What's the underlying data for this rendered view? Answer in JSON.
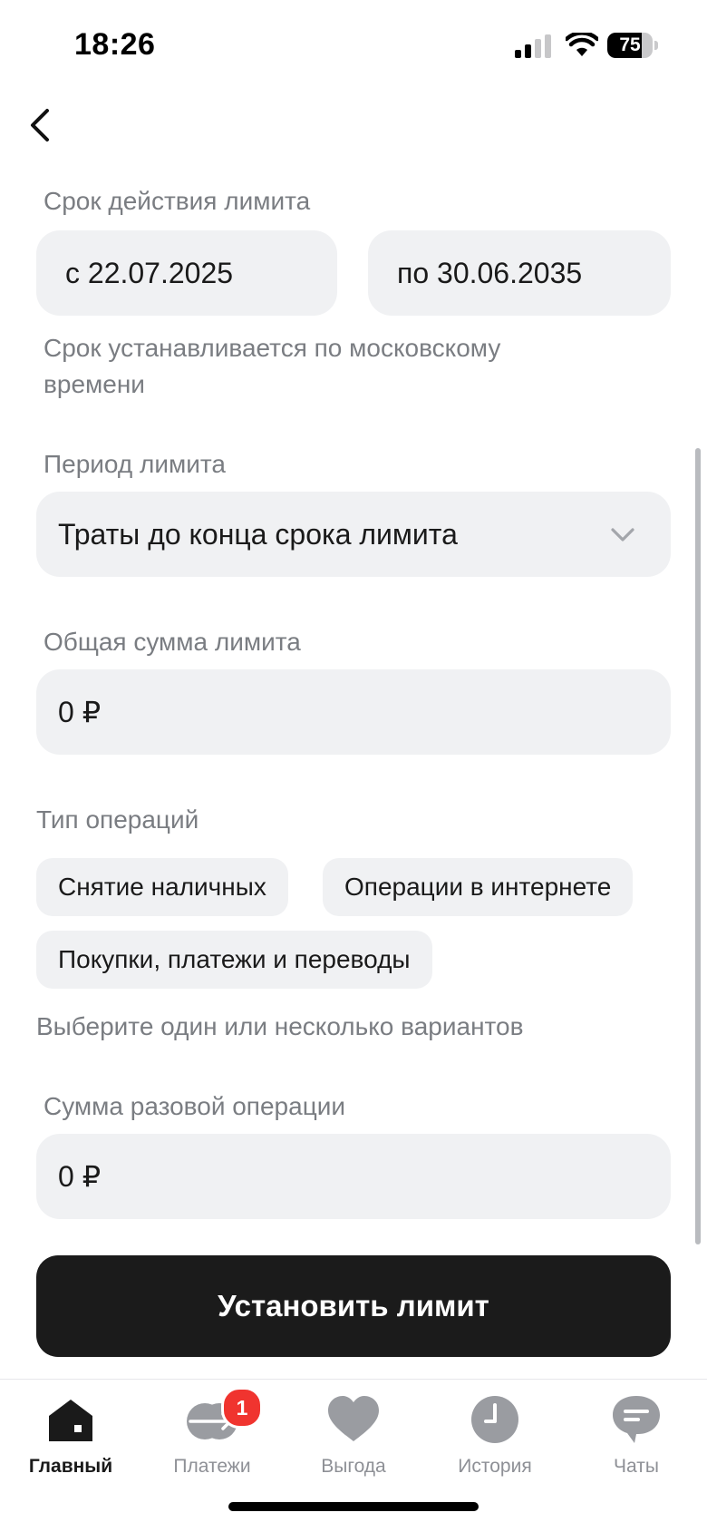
{
  "status_bar": {
    "time": "18:26",
    "battery": "75",
    "battery_level": 0.75
  },
  "back_button": {
    "icon": "chevron-left-icon"
  },
  "validity": {
    "label": "Срок действия лимита",
    "from": "с 22.07.2025",
    "to": "по 30.06.2035",
    "hint": "Срок устанавливается по московскому времени"
  },
  "period": {
    "label": "Период лимита",
    "selected": "Траты до конца срока лимита",
    "icon": "chevron-down-icon"
  },
  "total_amount": {
    "label": "Общая сумма лимита",
    "value": "0 ₽"
  },
  "operation_types": {
    "label": "Тип операций",
    "options": [
      "Снятие наличных",
      "Операции в интернете",
      "Покупки, платежи и переводы"
    ],
    "hint": "Выберите один или несколько вариантов"
  },
  "single_amount": {
    "label": "Сумма разовой операции",
    "value": "0 ₽"
  },
  "submit_label": "Установить лимит",
  "tabs": [
    {
      "label": "Главный",
      "icon": "home-icon",
      "active": true
    },
    {
      "label": "Платежи",
      "icon": "payments-icon",
      "badge": "1"
    },
    {
      "label": "Выгода",
      "icon": "heart-icon"
    },
    {
      "label": "История",
      "icon": "clock-icon"
    },
    {
      "label": "Чаты",
      "icon": "chat-icon"
    }
  ],
  "colors": {
    "field_bg": "#f0f1f3",
    "label_gray": "#7a7d82",
    "button_bg": "#1b1b1b",
    "badge_red": "#f0342f",
    "tab_icon_gray": "#9a9ca1"
  }
}
